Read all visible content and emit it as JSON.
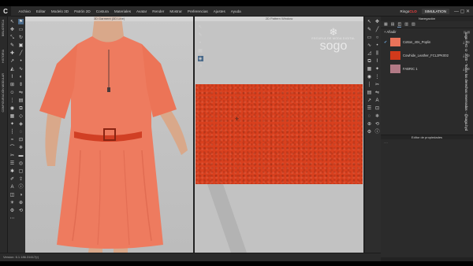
{
  "app": {
    "logo": "C"
  },
  "menu": [
    "Archivo",
    "Editar",
    "Modelo 3D",
    "Patrón 2D",
    "Costura",
    "Materiales",
    "Avatar",
    "Render",
    "Mostrar",
    "Preferencias",
    "Ajustes",
    "Ayuda"
  ],
  "user": {
    "name_prefix": "Ringo",
    "name_highlight": "CLO"
  },
  "mode_button": "SIMULATION",
  "window_controls": "— ▢ ✕",
  "side_tabs": [
    "BIBLIOTECA",
    "HISTORIA",
    "CONFIGURACIÓN MODULAR"
  ],
  "viewport3d": {
    "title": "3D Garment (3D Line)"
  },
  "viewport2d": {
    "title": "2D Pattern Window"
  },
  "watermark": {
    "glyph": "❄",
    "tagline": "ESCUELA DE MODA DIGITAL",
    "brand": "sogo"
  },
  "panel": {
    "title": "Navegación",
    "tabs": [
      "▦",
      "▤",
      "◫",
      "▥",
      "▧"
    ],
    "add_label": "+ Añadir",
    "options": "▤ ▦",
    "fabrics": [
      {
        "name": "Cotton_40s_Poplin",
        "color": "#e8735a",
        "checked": true
      },
      {
        "name": "Cowhide_Leather_FCL2PK002",
        "color": "#d23a1b",
        "checked": false
      },
      {
        "name": "FABRIC 1",
        "color": "#b27a86",
        "checked": false
      }
    ],
    "property_editor": "Editor de propiedades",
    "vertical_copyright": "sogo FHD © 2020 - Todos los derechos reservados - @sogo.byd"
  },
  "status": {
    "version": "Version: 6.1.186.31617(r)"
  },
  "colors": {
    "dress": "#ee7b5f",
    "belt": "#d13f24",
    "leather": "#d9401e"
  }
}
